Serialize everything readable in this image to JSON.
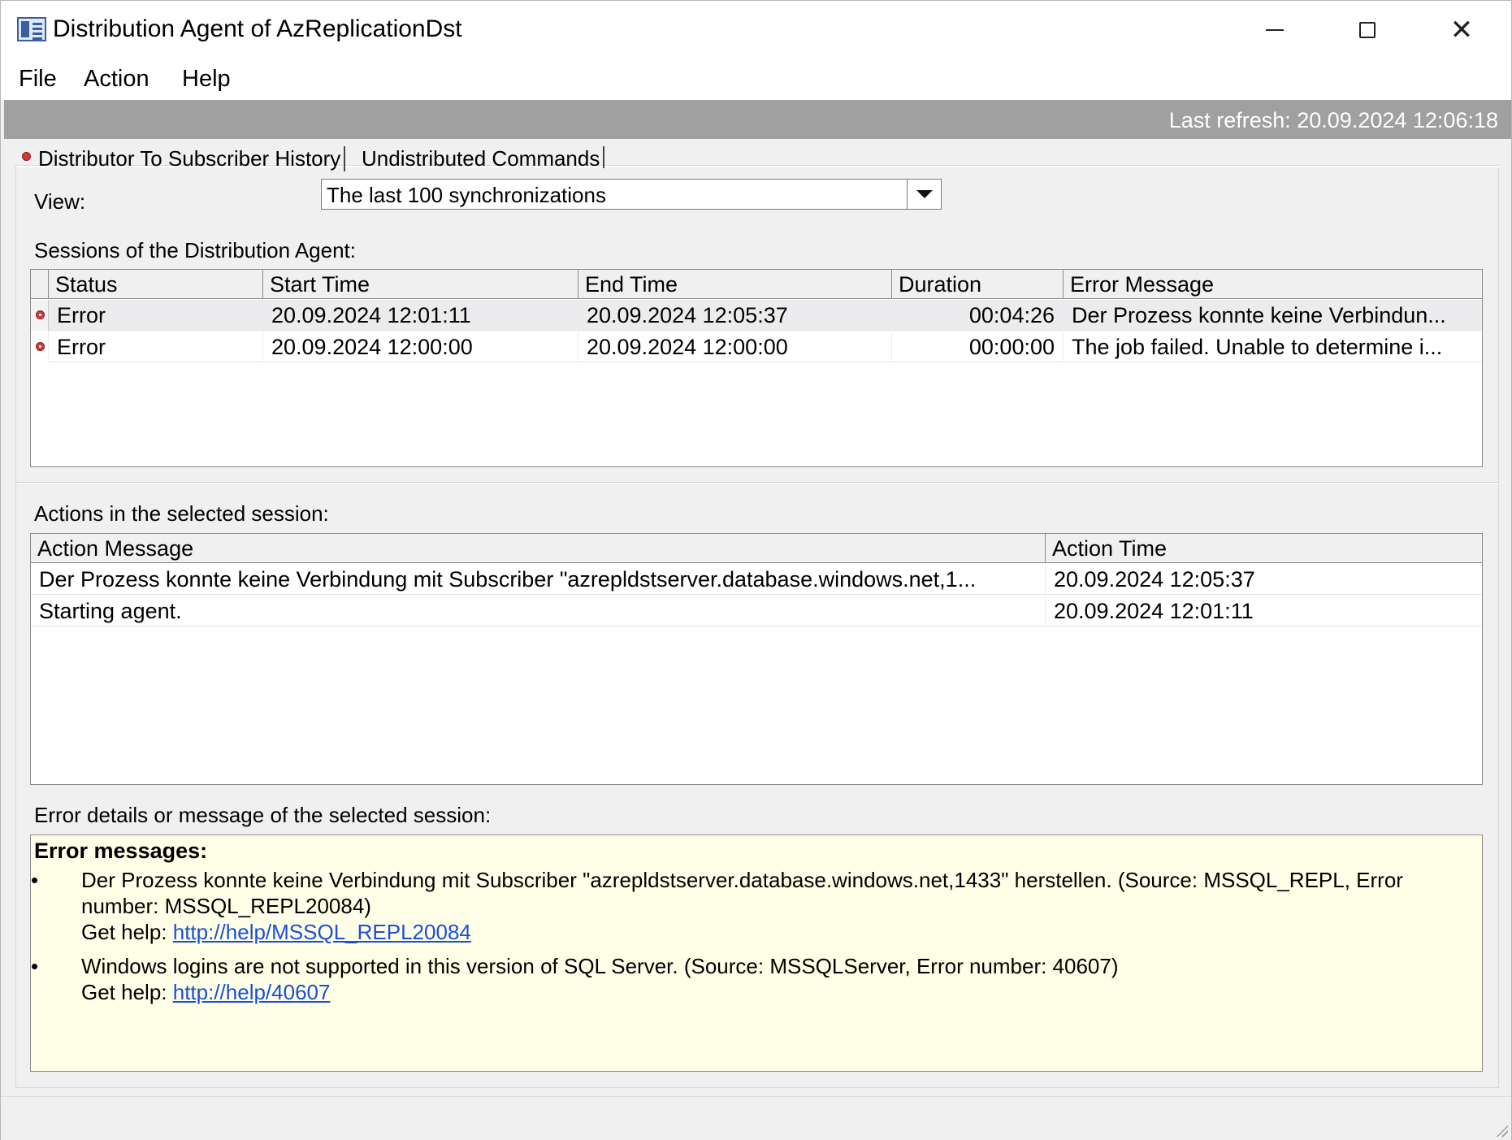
{
  "window": {
    "title": "Distribution Agent of AzReplicationDst",
    "icon": "app-window-icon"
  },
  "menu": [
    "File",
    "Action",
    "Help"
  ],
  "refresh": {
    "text": "Last refresh: 20.09.2024 12:06:18"
  },
  "tabs": [
    {
      "label": "Distributor To Subscriber History",
      "status": "error"
    },
    {
      "label": "Undistributed Commands"
    }
  ],
  "view": {
    "label": "View:",
    "selected": "The last 100 synchronizations"
  },
  "sessions": {
    "label": "Sessions of the Distribution Agent:",
    "columns": [
      "Status",
      "Start Time",
      "End Time",
      "Duration",
      "Error Message"
    ],
    "rows": [
      {
        "status": "Error",
        "start": "20.09.2024 12:01:11",
        "end": "20.09.2024 12:05:37",
        "duration": "00:04:26",
        "message": "Der Prozess konnte keine Verbindun..."
      },
      {
        "status": "Error",
        "start": "20.09.2024 12:00:00",
        "end": "20.09.2024 12:00:00",
        "duration": "00:00:00",
        "message": "The job failed.  Unable to determine i..."
      }
    ]
  },
  "actions": {
    "label": "Actions in the selected session:",
    "columns": [
      "Action Message",
      "Action Time"
    ],
    "rows": [
      {
        "message": "Der Prozess konnte keine Verbindung mit Subscriber \"azrepldstserver.database.windows.net,1...",
        "time": "20.09.2024 12:05:37"
      },
      {
        "message": "Starting agent.",
        "time": "20.09.2024 12:01:11"
      }
    ]
  },
  "details": {
    "label": "Error details or message of the selected session:",
    "title": "Error messages:",
    "items": [
      {
        "line1": "Der Prozess konnte keine Verbindung mit Subscriber \"azrepldstserver.database.windows.net,1433\" herstellen. (Source: MSSQL_REPL, Error",
        "line2": "number: MSSQL_REPL20084)",
        "help_prefix": "Get help: ",
        "help_link": "http://help/MSSQL_REPL20084"
      },
      {
        "line1": "Windows logins are not supported in this version of SQL Server. (Source: MSSQLServer, Error number: 40607)",
        "help_prefix": "Get help: ",
        "help_link": "http://help/40607"
      }
    ]
  },
  "colors": {
    "refresh_bar": "#a0a0a0",
    "error_box": "#ffffe8",
    "link": "#1a4fd6",
    "error_icon": "#d23a3a"
  }
}
